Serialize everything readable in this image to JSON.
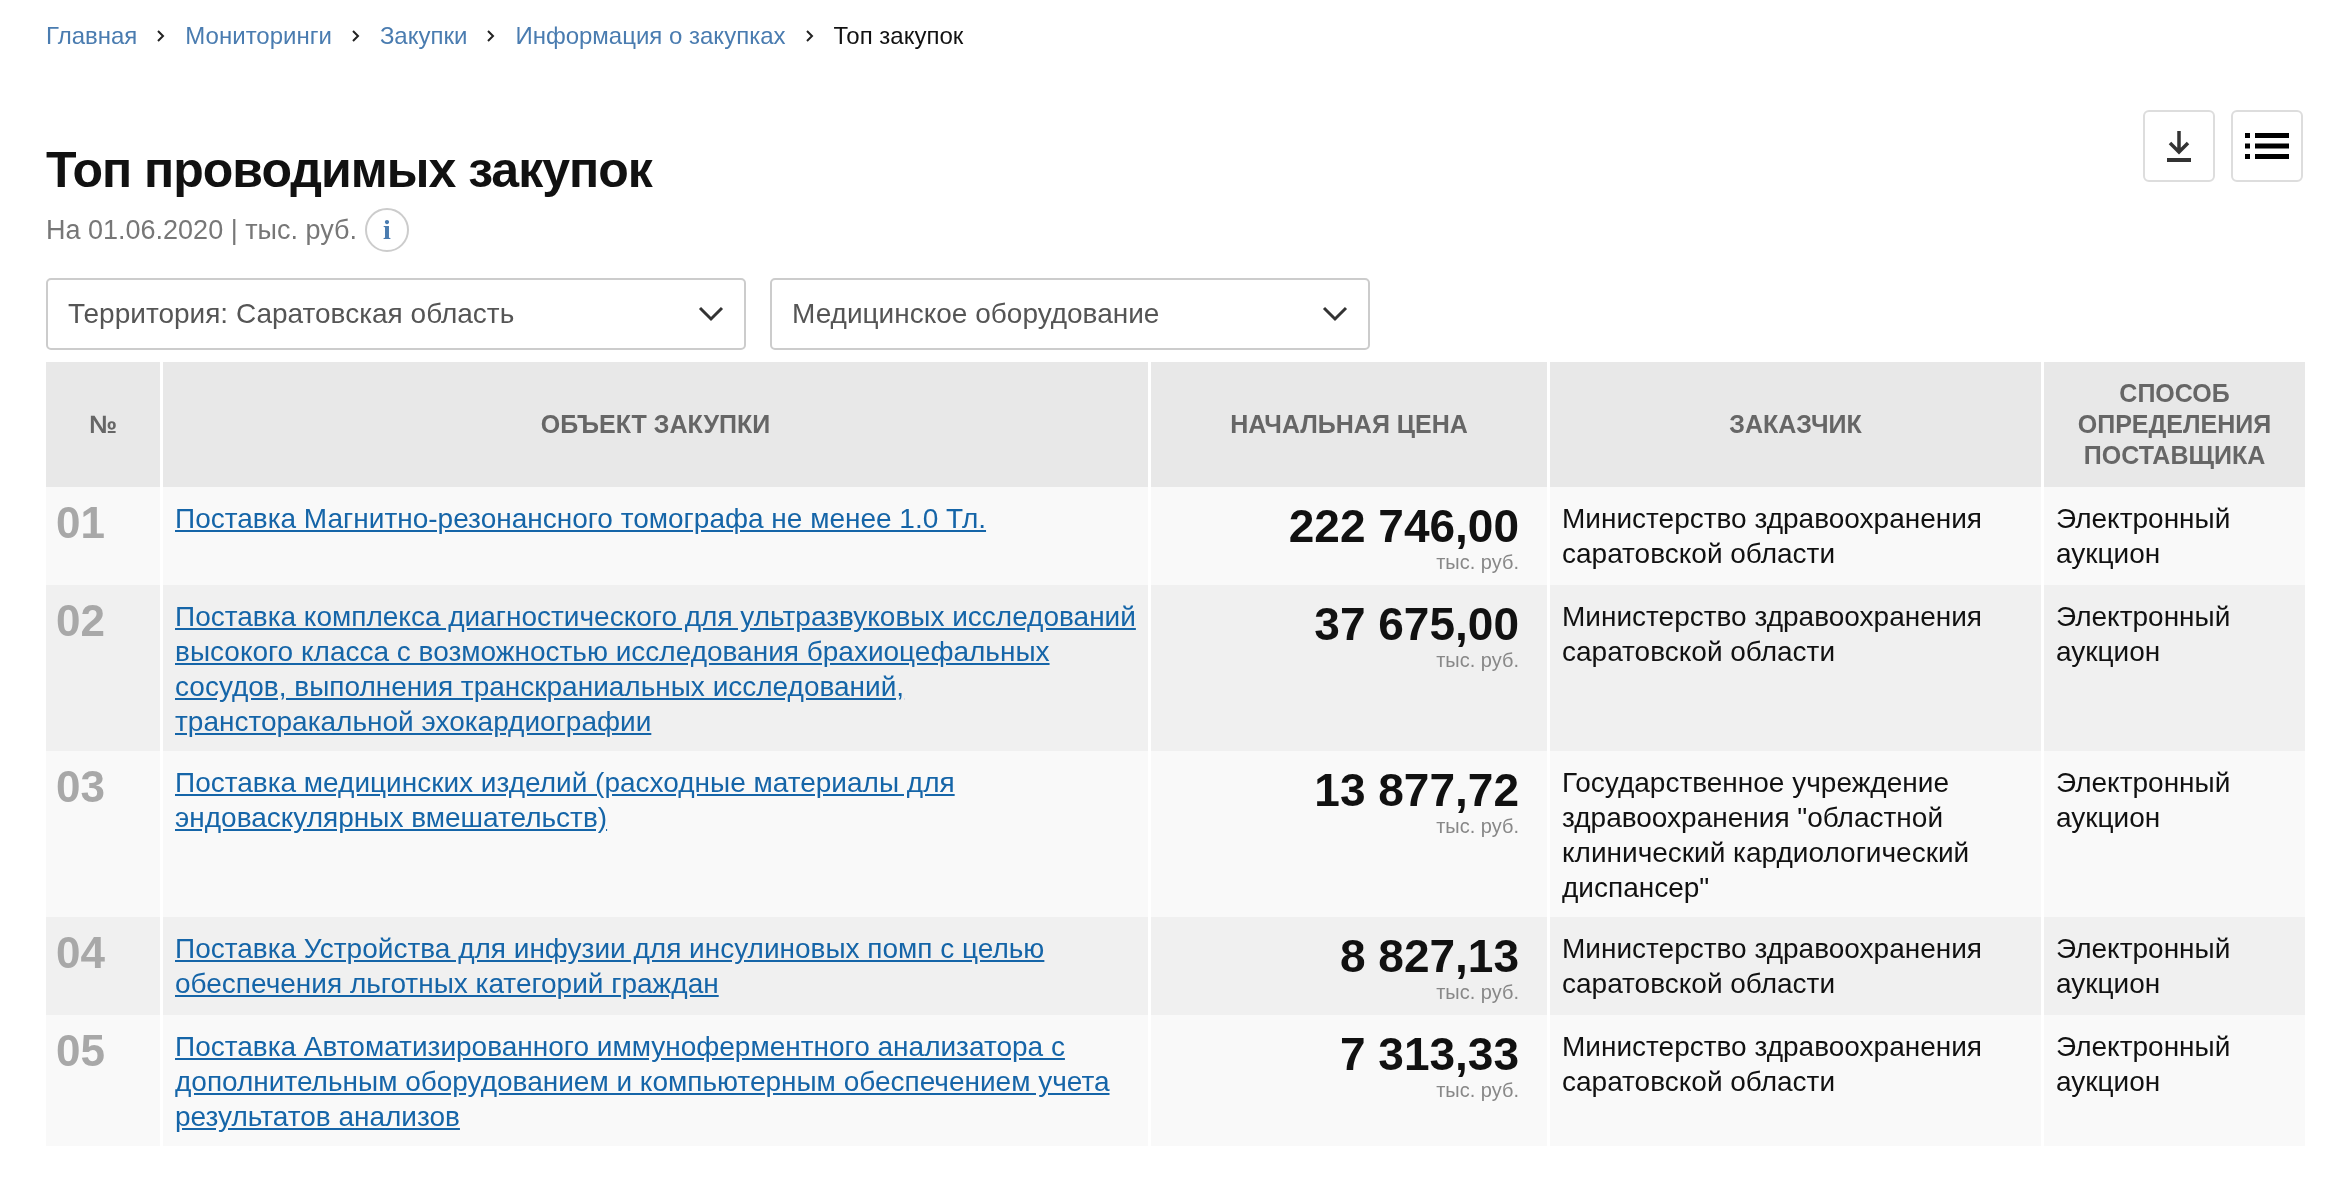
{
  "breadcrumbs": [
    {
      "label": "Главная",
      "current": false
    },
    {
      "label": "Мониторинги",
      "current": false
    },
    {
      "label": "Закупки",
      "current": false
    },
    {
      "label": "Информация о закупках",
      "current": false
    },
    {
      "label": "Топ закупок",
      "current": true
    }
  ],
  "title": "Топ проводимых закупок",
  "subtitle": "На 01.06.2020 | тыс. руб.",
  "info_icon": "i",
  "filters": [
    {
      "value": "Территория: Саратовская область"
    },
    {
      "value": "Медицинское оборудование"
    }
  ],
  "table": {
    "columns": [
      "№",
      "ОБЪЕКТ ЗАКУПКИ",
      "НАЧАЛЬНАЯ ЦЕНА",
      "ЗАКАЗЧИК",
      "СПОСОБ ОПРЕДЕЛЕНИЯ ПОСТАВЩИКА"
    ],
    "rows": [
      {
        "number": "01",
        "object": "Поставка Магнитно-резонансного томографа не менее 1.0 Тл.",
        "price": "222 746,00",
        "unit": "тыс. руб.",
        "customer": "Министерство здравоохранения саратовской области",
        "method": "Электронный аукцион"
      },
      {
        "number": "02",
        "object": "Поставка комплекса диагностического для ультразвуковых исследований высокого класса с возможностью исследования брахиоцефальных сосудов, выполнения транскраниальных исследований, трансторакальной эхокардиографии",
        "price": "37 675,00",
        "unit": "тыс. руб.",
        "customer": "Министерство здравоохранения саратовской области",
        "method": "Электронный аукцион"
      },
      {
        "number": "03",
        "object": "Поставка медицинских изделий (расходные материалы для эндоваскулярных вмешательств)",
        "price": "13 877,72",
        "unit": "тыс. руб.",
        "customer": "Государственное учреждение здравоохранения \"областной клинический кардиологический диспансер\"",
        "method": "Электронный аукцион"
      },
      {
        "number": "04",
        "object": "Поставка Устройства для инфузии для инсулиновых помп с целью обеспечения льготных категорий граждан",
        "price": "8 827,13",
        "unit": "тыс. руб.",
        "customer": "Министерство здравоохранения саратовской области",
        "method": "Электронный аукцион"
      },
      {
        "number": "05",
        "object": "Поставка Автоматизированного иммуноферментного анализатора с дополнительным оборудованием и компьютерным обеспечением учета результатов анализов",
        "price": "7 313,33",
        "unit": "тыс. руб.",
        "customer": "Министерство здравоохранения саратовской области",
        "method": "Электронный аукцион"
      }
    ]
  }
}
